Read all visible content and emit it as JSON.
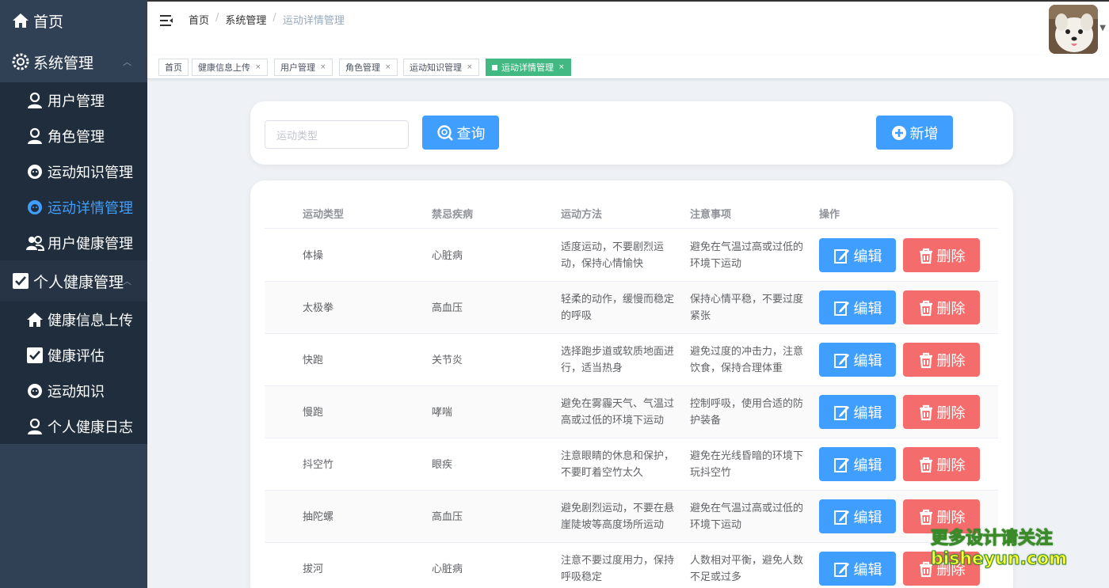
{
  "sidebar": {
    "home": "首页",
    "groups": [
      {
        "label": "系统管理",
        "items": [
          "用户管理",
          "角色管理",
          "运动知识管理",
          "运动详情管理",
          "用户健康管理"
        ]
      },
      {
        "label": "个人健康管理",
        "items": [
          "健康信息上传",
          "健康评估",
          "运动知识",
          "个人健康日志"
        ]
      }
    ]
  },
  "header": {
    "breadcrumb": [
      "首页",
      "系统管理",
      "运动详情管理"
    ],
    "separator": "/"
  },
  "tags": [
    "首页",
    "健康信息上传",
    "用户管理",
    "角色管理",
    "运动知识管理",
    "运动详情管理"
  ],
  "search": {
    "placeholder": "运动类型",
    "query_label": "查询",
    "add_label": "新增"
  },
  "table": {
    "columns": [
      "运动类型",
      "禁忌疾病",
      "运动方法",
      "注意事项",
      "操作"
    ],
    "rows": [
      {
        "type": "体操",
        "disease": "心脏病",
        "method": "适度运动，不要剧烈运动，保持心情愉快",
        "note": "避免在气温过高或过低的环境下运动"
      },
      {
        "type": "太极拳",
        "disease": "高血压",
        "method": "轻柔的动作，缓慢而稳定的呼吸",
        "note": "保持心情平稳，不要过度紧张"
      },
      {
        "type": "快跑",
        "disease": "关节炎",
        "method": "选择跑步道或软质地面进行，适当热身",
        "note": "避免过度的冲击力，注意饮食，保持合理体重"
      },
      {
        "type": "慢跑",
        "disease": "哮喘",
        "method": "避免在雾霾天气、气温过高或过低的环境下运动",
        "note": "控制呼吸，使用合适的防护装备"
      },
      {
        "type": "抖空竹",
        "disease": "眼疾",
        "method": "注意眼睛的休息和保护，不要盯着空竹太久",
        "note": "避免在光线昏暗的环境下玩抖空竹"
      },
      {
        "type": "抽陀螺",
        "disease": "高血压",
        "method": "避免剧烈运动，不要在悬崖陡坡等高度场所运动",
        "note": "避免在气温过高或过低的环境下运动"
      },
      {
        "type": "拔河",
        "disease": "心脏病",
        "method": "注意不要过度用力，保持呼吸稳定",
        "note": "人数相对平衡，避免人数不足或过多"
      }
    ],
    "edit_label": "编辑",
    "delete_label": "删除"
  },
  "watermark": {
    "line1": "更多设计请关注",
    "line2": "bisheyun.com"
  },
  "colors": {
    "sidebar": "#304156",
    "submenu": "#1f2d3d",
    "active": "#409eff",
    "primary": "#409eff",
    "danger": "#f56c6c",
    "tag_active": "#42b983"
  }
}
